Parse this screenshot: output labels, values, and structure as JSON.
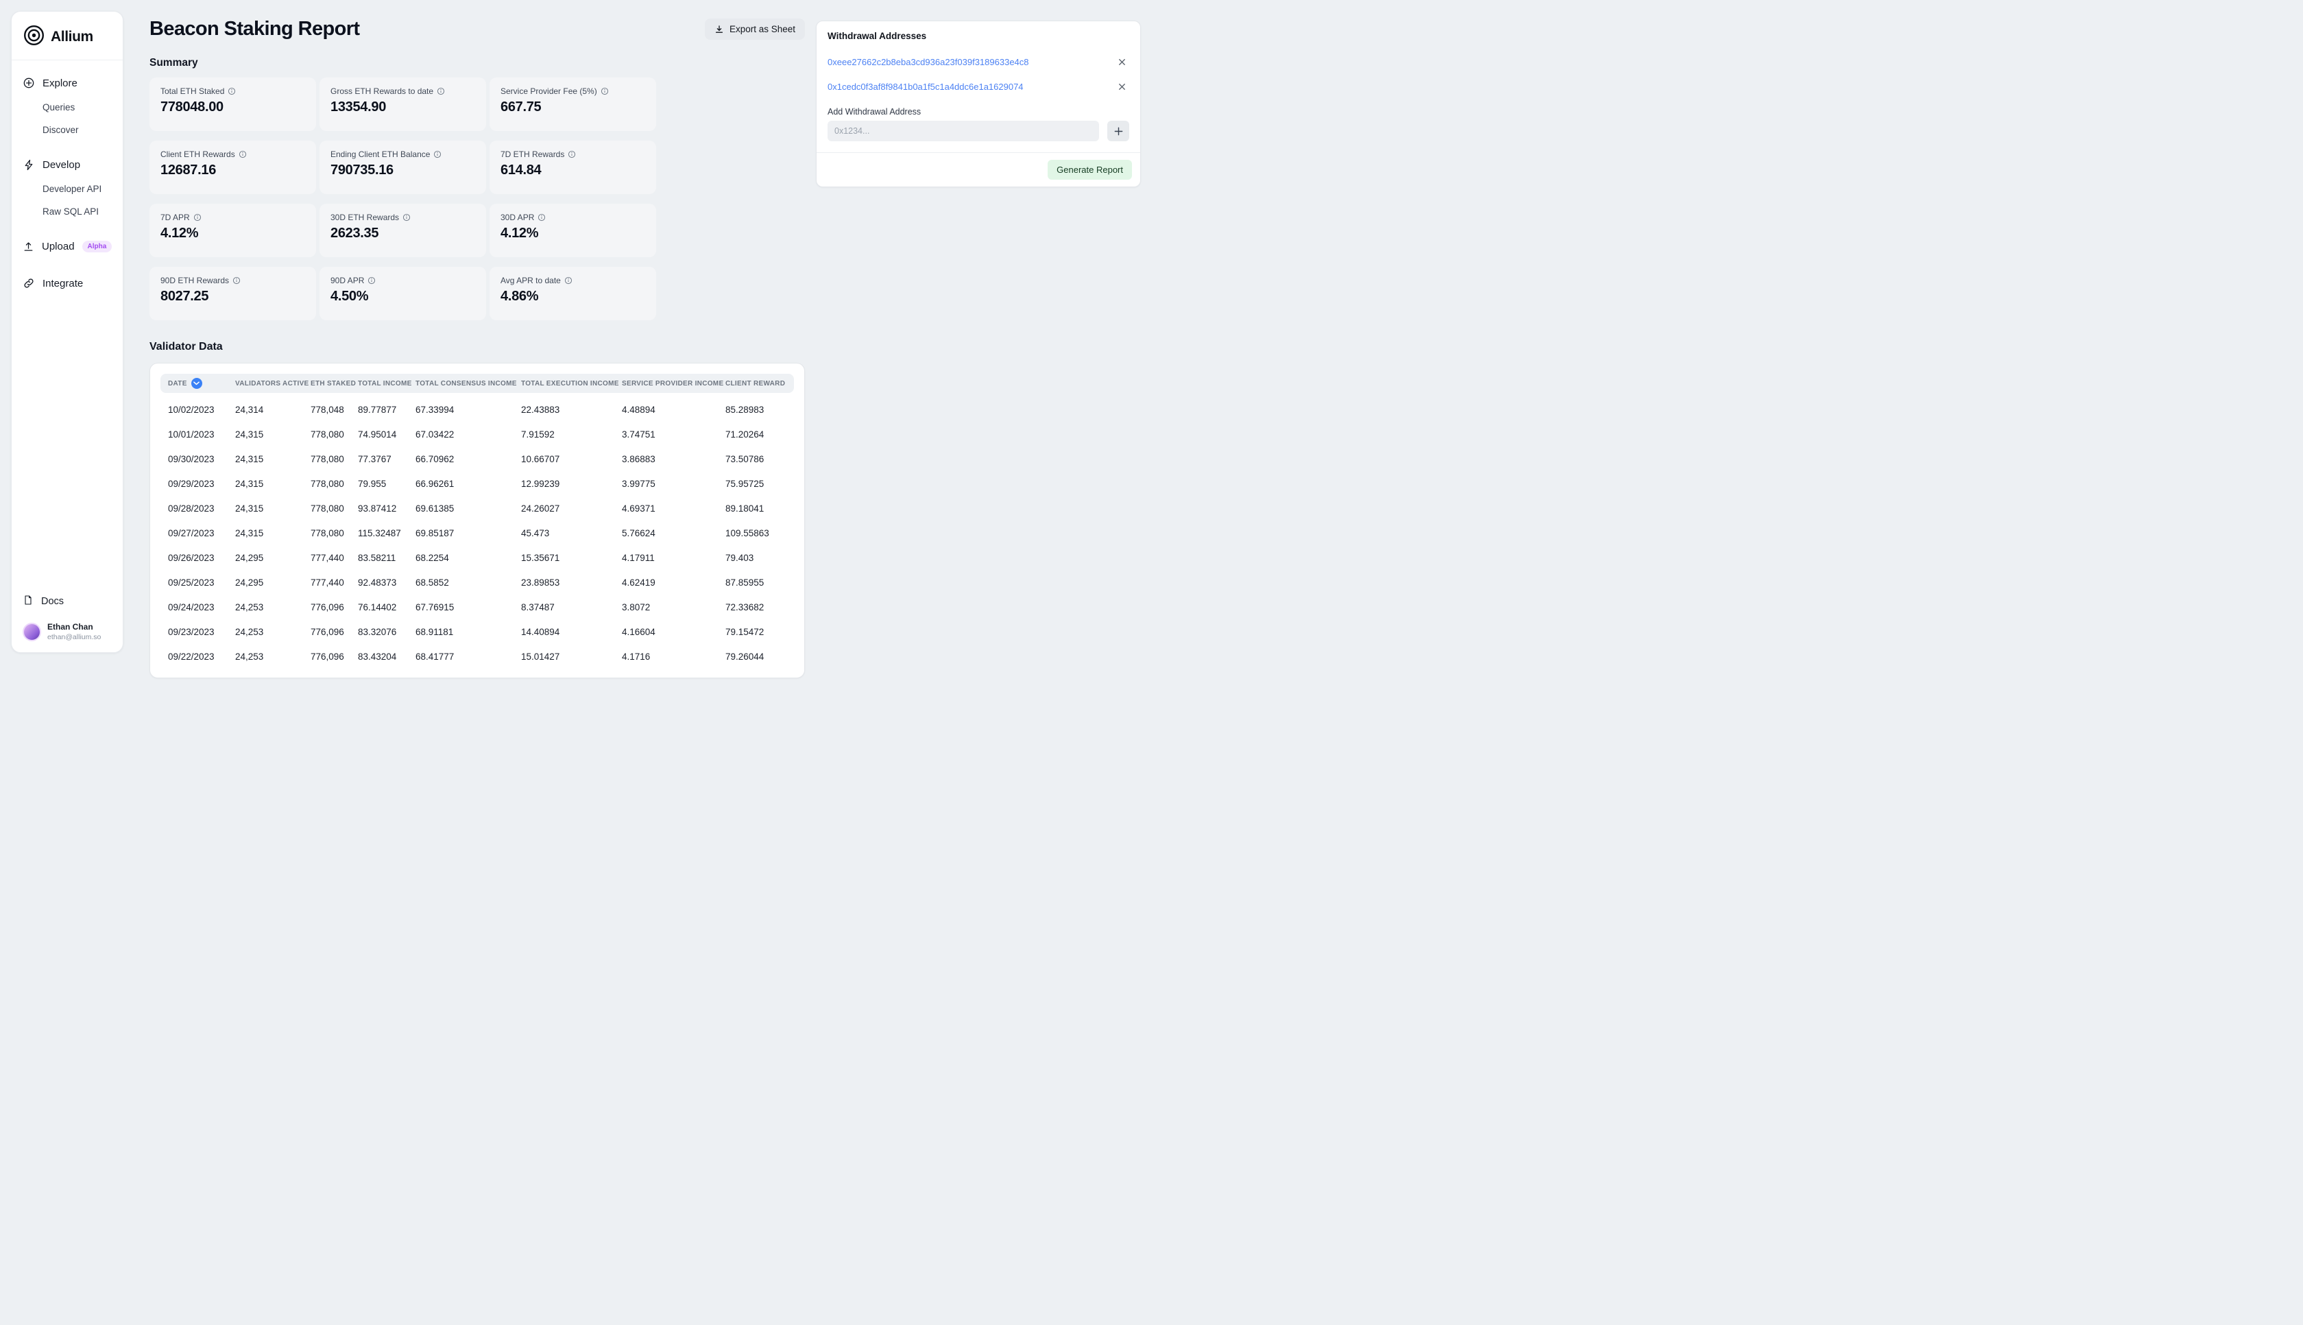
{
  "sidebar": {
    "brand": "Allium",
    "explore": {
      "label": "Explore",
      "children": [
        "Queries",
        "Discover"
      ]
    },
    "develop": {
      "label": "Develop",
      "children": [
        "Developer API",
        "Raw SQL API"
      ]
    },
    "upload": {
      "label": "Upload",
      "badge": "Alpha"
    },
    "integrate": {
      "label": "Integrate"
    },
    "docs": "Docs",
    "user": {
      "name": "Ethan Chan",
      "email": "ethan@allium.so"
    }
  },
  "header": {
    "title": "Beacon Staking Report",
    "export_label": "Export as Sheet"
  },
  "summary": {
    "title": "Summary",
    "cards": [
      {
        "label": "Total ETH Staked",
        "value": "778048.00"
      },
      {
        "label": "Gross ETH Rewards to date",
        "value": "13354.90"
      },
      {
        "label": "Service Provider Fee (5%)",
        "value": "667.75"
      },
      {
        "label": "Client ETH Rewards",
        "value": "12687.16"
      },
      {
        "label": "Ending Client ETH Balance",
        "value": "790735.16"
      },
      {
        "label": "7D ETH Rewards",
        "value": "614.84"
      },
      {
        "label": "7D APR",
        "value": "4.12%"
      },
      {
        "label": "30D ETH Rewards",
        "value": "2623.35"
      },
      {
        "label": "30D APR",
        "value": "4.12%"
      },
      {
        "label": "90D ETH Rewards",
        "value": "8027.25"
      },
      {
        "label": "90D APR",
        "value": "4.50%"
      },
      {
        "label": "Avg APR to date",
        "value": "4.86%"
      }
    ]
  },
  "withdrawal": {
    "title": "Withdrawal Addresses",
    "addresses": [
      "0xeee27662c2b8eba3cd936a23f039f3189633e4c8",
      "0x1cedc0f3af8f9841b0a1f5c1a4ddc6e1a1629074"
    ],
    "add_label": "Add Withdrawal Address",
    "input_placeholder": "0x1234...",
    "generate_label": "Generate Report"
  },
  "validator": {
    "title": "Validator Data",
    "columns": [
      "DATE",
      "VALIDATORS ACTIVE",
      "ETH STAKED",
      "TOTAL INCOME",
      "TOTAL CONSENSUS INCOME",
      "TOTAL EXECUTION INCOME",
      "SERVICE PROVIDER INCOME",
      "CLIENT REWARD"
    ],
    "rows": [
      [
        "10/02/2023",
        "24,314",
        "778,048",
        "89.77877",
        "67.33994",
        "22.43883",
        "4.48894",
        "85.28983"
      ],
      [
        "10/01/2023",
        "24,315",
        "778,080",
        "74.95014",
        "67.03422",
        "7.91592",
        "3.74751",
        "71.20264"
      ],
      [
        "09/30/2023",
        "24,315",
        "778,080",
        "77.3767",
        "66.70962",
        "10.66707",
        "3.86883",
        "73.50786"
      ],
      [
        "09/29/2023",
        "24,315",
        "778,080",
        "79.955",
        "66.96261",
        "12.99239",
        "3.99775",
        "75.95725"
      ],
      [
        "09/28/2023",
        "24,315",
        "778,080",
        "93.87412",
        "69.61385",
        "24.26027",
        "4.69371",
        "89.18041"
      ],
      [
        "09/27/2023",
        "24,315",
        "778,080",
        "115.32487",
        "69.85187",
        "45.473",
        "5.76624",
        "109.55863"
      ],
      [
        "09/26/2023",
        "24,295",
        "777,440",
        "83.58211",
        "68.2254",
        "15.35671",
        "4.17911",
        "79.403"
      ],
      [
        "09/25/2023",
        "24,295",
        "777,440",
        "92.48373",
        "68.5852",
        "23.89853",
        "4.62419",
        "87.85955"
      ],
      [
        "09/24/2023",
        "24,253",
        "776,096",
        "76.14402",
        "67.76915",
        "8.37487",
        "3.8072",
        "72.33682"
      ],
      [
        "09/23/2023",
        "24,253",
        "776,096",
        "83.32076",
        "68.91181",
        "14.40894",
        "4.16604",
        "79.15472"
      ],
      [
        "09/22/2023",
        "24,253",
        "776,096",
        "83.43204",
        "68.41777",
        "15.01427",
        "4.1716",
        "79.26044"
      ]
    ]
  },
  "icons": {
    "export": "download-icon",
    "stat_hint": "info-icon",
    "date_sort": "chevron-down-icon",
    "remove_address": "close-icon",
    "add_address": "plus-icon"
  },
  "colors": {
    "link_blue": "#4d82f3",
    "sort_chip_blue": "#3b82f6",
    "generate_button_bg": "#e1f6e6",
    "alpha_badge_purple": "#a34df0",
    "page_background": "#edf0f3"
  }
}
